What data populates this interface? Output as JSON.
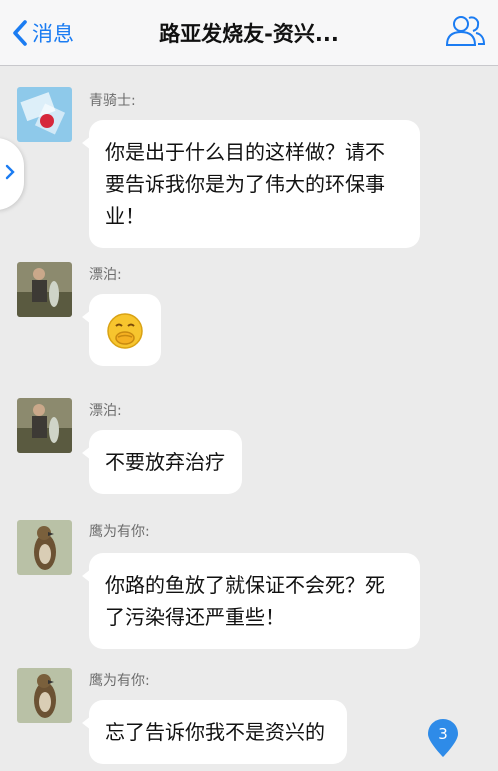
{
  "nav": {
    "back_label": "消息",
    "title": "路亚发烧友-资兴...",
    "back_icon": "chevron-left-icon",
    "members_icon": "group-members-icon"
  },
  "messages": [
    {
      "sender": "青骑士:",
      "text": "你是出于什么目的这样做？请不要告诉我你是为了伟大的环保事业！"
    },
    {
      "sender": "漂泊:",
      "emoji": "covering-mouth-emoji"
    },
    {
      "sender": "漂泊:",
      "text": "不要放弃治疗"
    },
    {
      "sender": "鹰为有你:",
      "text": "你路的鱼放了就保证不会死？死了污染得还严重些！"
    },
    {
      "sender": "鹰为有你:",
      "text": "忘了告诉你我不是资兴的"
    }
  ],
  "unread_badge": "3",
  "colors": {
    "accent": "#1b7cf2",
    "badge": "#2e8be8",
    "background": "#ebebeb"
  }
}
